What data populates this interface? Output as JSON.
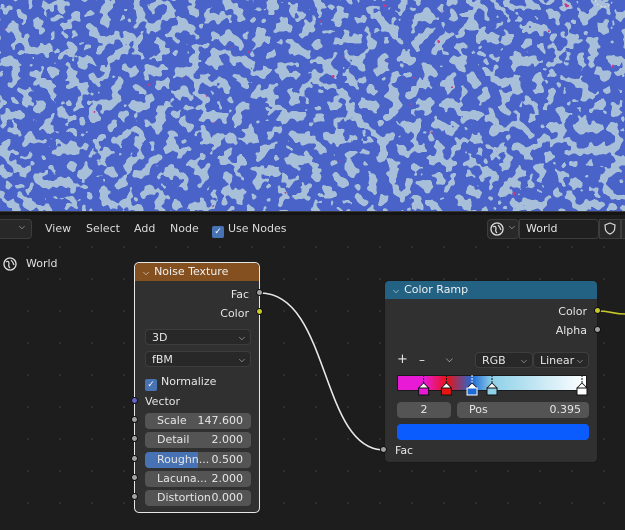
{
  "header": {
    "menu_view": "View",
    "menu_select": "Select",
    "menu_add": "Add",
    "menu_node": "Node",
    "use_nodes_label": "Use Nodes",
    "use_nodes_checked": true,
    "world_field": "World"
  },
  "breadcrumb": {
    "label": "World"
  },
  "noise_node": {
    "title": "Noise Texture",
    "header_color": "#84501f",
    "out_fac": "Fac",
    "out_color": "Color",
    "dimensions": "3D",
    "type": "fBM",
    "normalize_label": "Normalize",
    "normalize_checked": true,
    "vector_label": "Vector",
    "fields": [
      {
        "label": "Scale",
        "value": "147.600"
      },
      {
        "label": "Detail",
        "value": "2.000"
      },
      {
        "label": "Roughn...",
        "value": "0.500",
        "fraction": 0.5
      },
      {
        "label": "Lacuna...",
        "value": "2.000"
      },
      {
        "label": "Distortion",
        "value": "0.000"
      }
    ]
  },
  "ramp_node": {
    "title": "Color Ramp",
    "header_color": "#246283",
    "out_color": "Color",
    "out_alpha": "Alpha",
    "add_symbol": "+",
    "remove_symbol": "–",
    "color_mode": "RGB",
    "interpolation": "Linear",
    "active_index": "2",
    "pos_label": "Pos",
    "pos_value": "0.395",
    "active_color": "#0a5cff",
    "in_fac": "Fac",
    "stops": [
      {
        "pos": 0.14,
        "color": "#e81ad6"
      },
      {
        "pos": 0.26,
        "color": "#e81313"
      },
      {
        "pos": 0.395,
        "color": "#1f6bd6"
      },
      {
        "pos": 0.5,
        "color": "#8ed0e8"
      },
      {
        "pos": 1.0,
        "color": "#ffffff"
      }
    ]
  },
  "colors": {
    "socket_float": "#a1a1a1",
    "socket_color": "#c7c729",
    "socket_vector": "#6363c7",
    "accent": "#4772b3"
  }
}
